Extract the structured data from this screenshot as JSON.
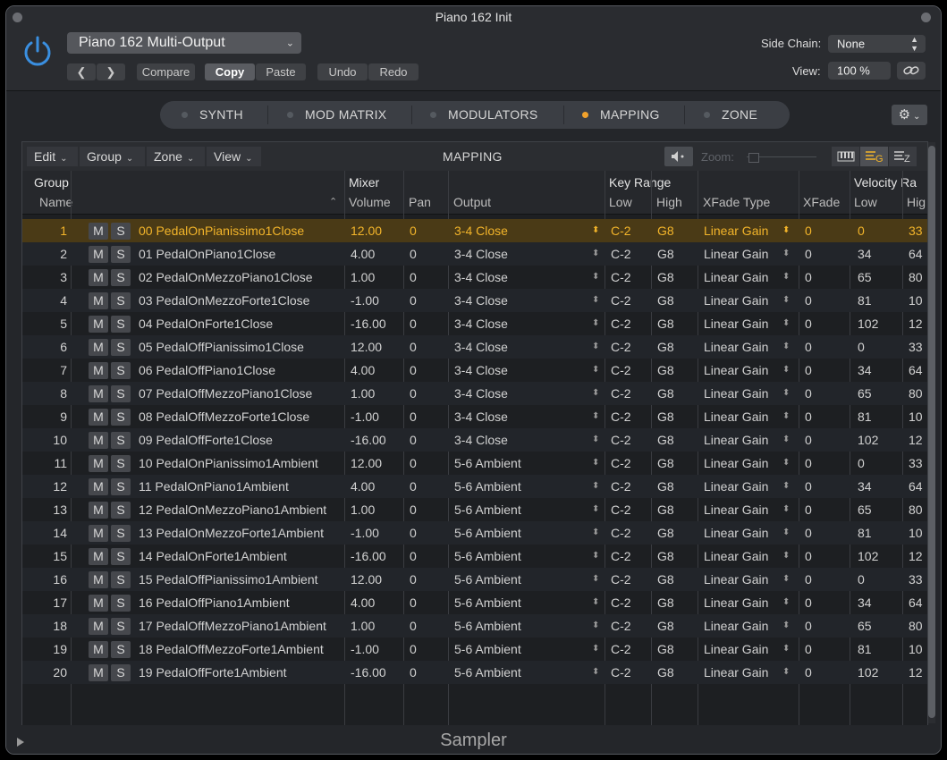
{
  "window": {
    "title": "Piano 162 Init"
  },
  "header": {
    "preset": "Piano 162 Multi-Output",
    "compare": "Compare",
    "copy": "Copy",
    "paste": "Paste",
    "undo": "Undo",
    "redo": "Redo",
    "side_chain_label": "Side Chain:",
    "side_chain_value": "None",
    "view_label": "View:",
    "view_value": "100 %"
  },
  "tabs": [
    "SYNTH",
    "MOD MATRIX",
    "MODULATORS",
    "MAPPING",
    "ZONE"
  ],
  "active_tab": "MAPPING",
  "panel": {
    "menus": [
      "Edit",
      "Group",
      "Zone",
      "View"
    ],
    "title": "MAPPING",
    "zoom_label": "Zoom:"
  },
  "columns": {
    "group": "Group",
    "name": "Name",
    "mixer": "Mixer",
    "volume": "Volume",
    "pan": "Pan",
    "output": "Output",
    "key_range": "Key Range",
    "low": "Low",
    "high": "High",
    "xfade_type": "XFade Type",
    "xfade": "XFade",
    "velocity": "Velocity Ra",
    "vlow": "Low",
    "vhigh": "Hig"
  },
  "mute": "M",
  "solo": "S",
  "rows": [
    {
      "n": "1",
      "name": "00 PedalOnPianissimo1Close",
      "vol": "12.00",
      "pan": "0",
      "out": "3-4 Close",
      "low": "C-2",
      "high": "G8",
      "xft": "Linear Gain",
      "xf": "0",
      "vl": "0",
      "vh": "33"
    },
    {
      "n": "2",
      "name": "01 PedalOnPiano1Close",
      "vol": "4.00",
      "pan": "0",
      "out": "3-4 Close",
      "low": "C-2",
      "high": "G8",
      "xft": "Linear Gain",
      "xf": "0",
      "vl": "34",
      "vh": "64"
    },
    {
      "n": "3",
      "name": "02 PedalOnMezzoPiano1Close",
      "vol": "1.00",
      "pan": "0",
      "out": "3-4 Close",
      "low": "C-2",
      "high": "G8",
      "xft": "Linear Gain",
      "xf": "0",
      "vl": "65",
      "vh": "80"
    },
    {
      "n": "4",
      "name": "03 PedalOnMezzoForte1Close",
      "vol": "-1.00",
      "pan": "0",
      "out": "3-4 Close",
      "low": "C-2",
      "high": "G8",
      "xft": "Linear Gain",
      "xf": "0",
      "vl": "81",
      "vh": "10"
    },
    {
      "n": "5",
      "name": "04 PedalOnForte1Close",
      "vol": "-16.00",
      "pan": "0",
      "out": "3-4 Close",
      "low": "C-2",
      "high": "G8",
      "xft": "Linear Gain",
      "xf": "0",
      "vl": "102",
      "vh": "12"
    },
    {
      "n": "6",
      "name": "05 PedalOffPianissimo1Close",
      "vol": "12.00",
      "pan": "0",
      "out": "3-4 Close",
      "low": "C-2",
      "high": "G8",
      "xft": "Linear Gain",
      "xf": "0",
      "vl": "0",
      "vh": "33"
    },
    {
      "n": "7",
      "name": "06 PedalOffPiano1Close",
      "vol": "4.00",
      "pan": "0",
      "out": "3-4 Close",
      "low": "C-2",
      "high": "G8",
      "xft": "Linear Gain",
      "xf": "0",
      "vl": "34",
      "vh": "64"
    },
    {
      "n": "8",
      "name": "07 PedalOffMezzoPiano1Close",
      "vol": "1.00",
      "pan": "0",
      "out": "3-4 Close",
      "low": "C-2",
      "high": "G8",
      "xft": "Linear Gain",
      "xf": "0",
      "vl": "65",
      "vh": "80"
    },
    {
      "n": "9",
      "name": "08 PedalOffMezzoForte1Close",
      "vol": "-1.00",
      "pan": "0",
      "out": "3-4 Close",
      "low": "C-2",
      "high": "G8",
      "xft": "Linear Gain",
      "xf": "0",
      "vl": "81",
      "vh": "10"
    },
    {
      "n": "10",
      "name": "09 PedalOffForte1Close",
      "vol": "-16.00",
      "pan": "0",
      "out": "3-4 Close",
      "low": "C-2",
      "high": "G8",
      "xft": "Linear Gain",
      "xf": "0",
      "vl": "102",
      "vh": "12"
    },
    {
      "n": "11",
      "name": "10 PedalOnPianissimo1Ambient",
      "vol": "12.00",
      "pan": "0",
      "out": "5-6 Ambient",
      "low": "C-2",
      "high": "G8",
      "xft": "Linear Gain",
      "xf": "0",
      "vl": "0",
      "vh": "33"
    },
    {
      "n": "12",
      "name": "11 PedalOnPiano1Ambient",
      "vol": "4.00",
      "pan": "0",
      "out": "5-6 Ambient",
      "low": "C-2",
      "high": "G8",
      "xft": "Linear Gain",
      "xf": "0",
      "vl": "34",
      "vh": "64"
    },
    {
      "n": "13",
      "name": "12 PedalOnMezzoPiano1Ambient",
      "vol": "1.00",
      "pan": "0",
      "out": "5-6 Ambient",
      "low": "C-2",
      "high": "G8",
      "xft": "Linear Gain",
      "xf": "0",
      "vl": "65",
      "vh": "80"
    },
    {
      "n": "14",
      "name": "13 PedalOnMezzoForte1Ambient",
      "vol": "-1.00",
      "pan": "0",
      "out": "5-6 Ambient",
      "low": "C-2",
      "high": "G8",
      "xft": "Linear Gain",
      "xf": "0",
      "vl": "81",
      "vh": "10"
    },
    {
      "n": "15",
      "name": "14 PedalOnForte1Ambient",
      "vol": "-16.00",
      "pan": "0",
      "out": "5-6 Ambient",
      "low": "C-2",
      "high": "G8",
      "xft": "Linear Gain",
      "xf": "0",
      "vl": "102",
      "vh": "12"
    },
    {
      "n": "16",
      "name": "15 PedalOffPianissimo1Ambient",
      "vol": "12.00",
      "pan": "0",
      "out": "5-6 Ambient",
      "low": "C-2",
      "high": "G8",
      "xft": "Linear Gain",
      "xf": "0",
      "vl": "0",
      "vh": "33"
    },
    {
      "n": "17",
      "name": "16 PedalOffPiano1Ambient",
      "vol": "4.00",
      "pan": "0",
      "out": "5-6 Ambient",
      "low": "C-2",
      "high": "G8",
      "xft": "Linear Gain",
      "xf": "0",
      "vl": "34",
      "vh": "64"
    },
    {
      "n": "18",
      "name": "17 PedalOffMezzoPiano1Ambient",
      "vol": "1.00",
      "pan": "0",
      "out": "5-6 Ambient",
      "low": "C-2",
      "high": "G8",
      "xft": "Linear Gain",
      "xf": "0",
      "vl": "65",
      "vh": "80"
    },
    {
      "n": "19",
      "name": "18 PedalOffMezzoForte1Ambient",
      "vol": "-1.00",
      "pan": "0",
      "out": "5-6 Ambient",
      "low": "C-2",
      "high": "G8",
      "xft": "Linear Gain",
      "xf": "0",
      "vl": "81",
      "vh": "10"
    },
    {
      "n": "20",
      "name": "19 PedalOffForte1Ambient",
      "vol": "-16.00",
      "pan": "0",
      "out": "5-6 Ambient",
      "low": "C-2",
      "high": "G8",
      "xft": "Linear Gain",
      "xf": "0",
      "vl": "102",
      "vh": "12"
    }
  ],
  "footer": {
    "label": "Sampler"
  },
  "colors": {
    "accent": "#f2b42a",
    "power": "#3a8fe0",
    "selected_row": "#4a3a16"
  }
}
